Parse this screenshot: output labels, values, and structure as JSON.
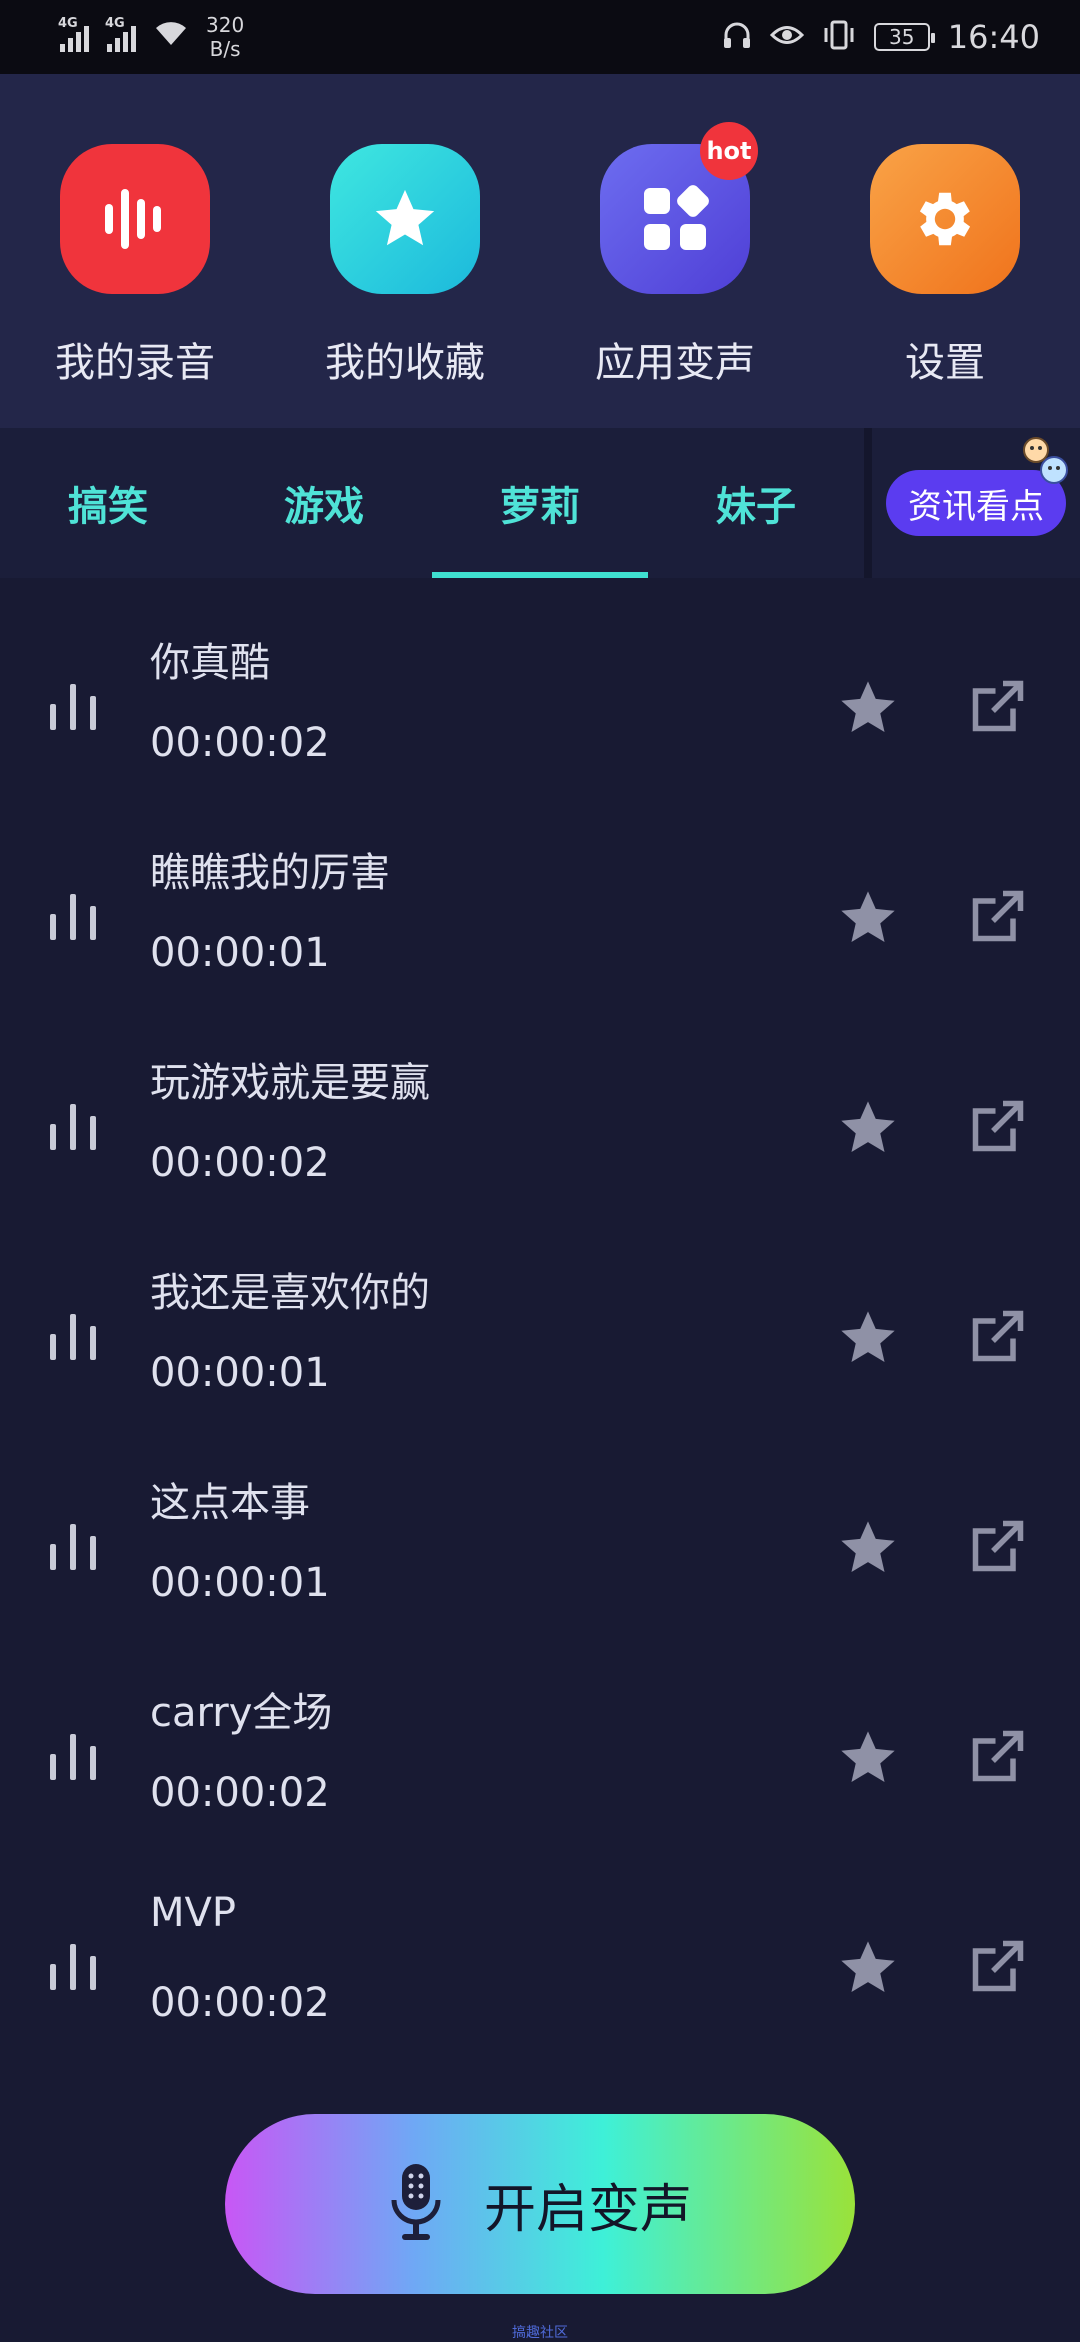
{
  "status_bar": {
    "network1": "4G",
    "network2": "4G",
    "speed_value": "320",
    "speed_unit": "B/s",
    "battery": "35",
    "time": "16:40"
  },
  "quick_actions": [
    {
      "label": "我的录音",
      "icon": "voice-bars-icon",
      "color": "#f0343c"
    },
    {
      "label": "我的收藏",
      "icon": "star-icon",
      "color": "#2ed3e0"
    },
    {
      "label": "应用变声",
      "icon": "apps-grid-icon",
      "color": "#5b55e8",
      "badge": "hot"
    },
    {
      "label": "设置",
      "icon": "gear-icon",
      "color": "#f48a2a"
    }
  ],
  "tabs": [
    {
      "label": "搞笑"
    },
    {
      "label": "游戏"
    },
    {
      "label": "萝莉",
      "active": true
    },
    {
      "label": "妹子"
    }
  ],
  "news_button": "资讯看点",
  "voices": [
    {
      "title": "你真酷",
      "duration": "00:00:02"
    },
    {
      "title": "瞧瞧我的厉害",
      "duration": "00:00:01"
    },
    {
      "title": "玩游戏就是要赢",
      "duration": "00:00:02"
    },
    {
      "title": "我还是喜欢你的",
      "duration": "00:00:01"
    },
    {
      "title": "这点本事",
      "duration": "00:00:01"
    },
    {
      "title": "carry全场",
      "duration": "00:00:02"
    },
    {
      "title": "MVP",
      "duration": "00:00:02"
    }
  ],
  "start_button": "开启变声",
  "footer": "搞趣社区",
  "colors": {
    "background": "#181a33",
    "accent": "#3fe0d0",
    "header": "#232649"
  }
}
